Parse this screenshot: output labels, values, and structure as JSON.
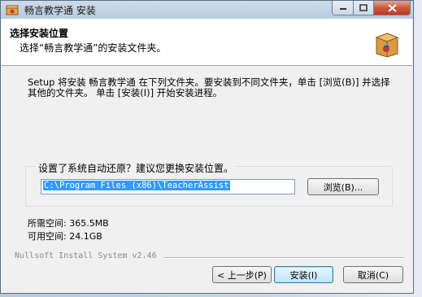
{
  "window": {
    "title": "畅言教学通 安装"
  },
  "header": {
    "title": "选择安装位置",
    "subtitle": "选择“畅言教学通”的安装文件夹。"
  },
  "description": "Setup 将安装 畅言教学通 在下列文件夹。要安装到不同文件夹，单击 [浏览(B)] 并选择其他的文件夹。 单击 [安装(I)] 开始安装进程。",
  "destination": {
    "legend": "设置了系统自动还原？建议您更换安装位置。",
    "path": "C:\\Program Files (x86)\\TeacherAssist",
    "browse_label": "浏览(B)..."
  },
  "space": {
    "required": "所需空间: 365.5MB",
    "available": "可用空间: 24.1GB"
  },
  "footer": {
    "brand": "Nullsoft Install System v2.46"
  },
  "buttons": {
    "back": "< 上一步(P)",
    "install": "安装(I)",
    "cancel": "取消(C)"
  }
}
